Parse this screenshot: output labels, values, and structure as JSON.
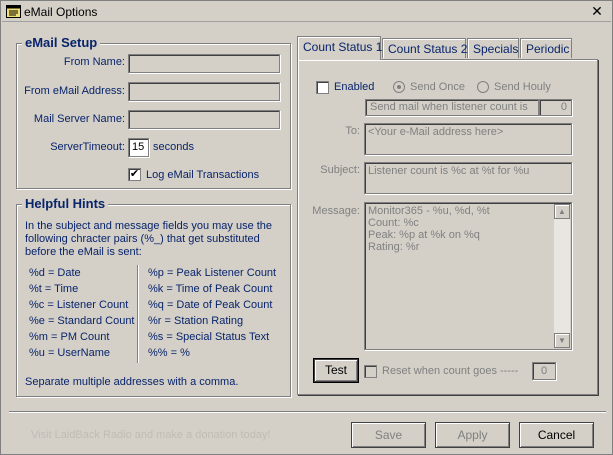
{
  "window": {
    "title": "eMail Options",
    "close_glyph": "✕"
  },
  "setup": {
    "title": "eMail Setup",
    "from_name_label": "From Name:",
    "from_email_label": "From eMail Address:",
    "mail_server_label": "Mail Server Name:",
    "server_timeout_label": "ServerTimeout:",
    "server_timeout_value": "15",
    "seconds_label": "seconds",
    "log_label": "Log eMail Transactions",
    "log_checked": "✔"
  },
  "hints": {
    "title": "Helpful Hints",
    "intro_1": "In the subject and message fields you may use the",
    "intro_2": "following chracter pairs (%_) that get substituted",
    "intro_3": "before the eMail is sent:",
    "left": [
      "%d = Date",
      "%t = Time",
      "%c = Listener Count",
      "%e = Standard Count",
      "%m = PM Count",
      "%u = UserName"
    ],
    "right": [
      "%p = Peak Listener Count",
      "%k = Time of Peak Count",
      "%q = Date of Peak Count",
      "%r = Station Rating",
      "%s = Special Status Text",
      "%% = %"
    ],
    "footer": "Separate multiple addresses with a comma."
  },
  "tabs": [
    "Count Status 1",
    "Count Status 2",
    "Specials",
    "Periodic"
  ],
  "panel": {
    "enabled_label": "Enabled",
    "send_once_label": "Send Once",
    "send_hourly_label": "Send Houly",
    "send_when_label": "Send mail when listener count is",
    "count_value": "0",
    "to_label": "To:",
    "to_value": "<Your e-Mail address here>",
    "subject_label": "Subject:",
    "subject_value": "Listener count is %c at %t for %u",
    "message_label": "Message:",
    "message_value": "Monitor365 - %u, %d, %t\nCount: %c\nPeak: %p at %k on %q\nRating: %r",
    "test_button": "Test",
    "reset_label": "Reset when count goes -----",
    "reset_value": "0"
  },
  "footer": {
    "promo_text": "Visit LaidBack Radio and make a donation today!",
    "save_button": "Save",
    "apply_button": "Apply",
    "cancel_button": "Cancel"
  },
  "icons": {
    "title_icon": "notepad-icon",
    "scroll_up": "▲",
    "scroll_down": "▼"
  },
  "colors": {
    "accent": "#08246b",
    "background": "#d4d0c8",
    "disabled_text": "#808080"
  }
}
